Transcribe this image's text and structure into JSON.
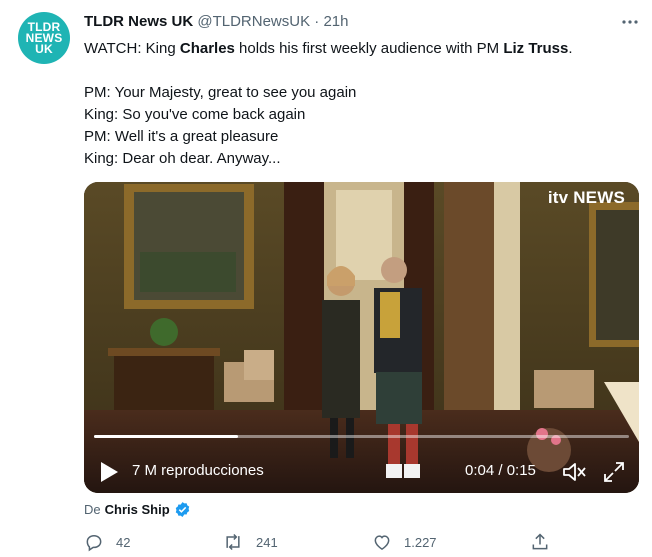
{
  "account": {
    "avatar_lines": [
      "TLDR",
      "NEWS",
      "UK"
    ],
    "display_name": "TLDR News UK",
    "handle": "@TLDRNewsUK",
    "separator": "·",
    "time": "21h"
  },
  "tweet": {
    "intro_prefix": "WATCH: King ",
    "bold_1": "Charles",
    "intro_middle": " holds his first weekly audience with PM ",
    "bold_2": "Liz Truss",
    "intro_suffix": ".",
    "dialogue": [
      "PM: Your Majesty, great to see you again",
      "King: So you've come back again",
      "PM: Well it's a great pleasure",
      "King: Dear oh dear. Anyway..."
    ]
  },
  "video": {
    "logo": "itv NEWS",
    "views": "7 M reproducciones",
    "time": "0:04 / 0:15",
    "progress": 0.27
  },
  "source": {
    "prefix": "De",
    "author": "Chris Ship"
  },
  "actions": {
    "replies": "42",
    "retweets": "241",
    "likes": "1.227"
  },
  "icons": [
    "more-icon",
    "play-icon",
    "mute-icon",
    "expand-icon",
    "verified-icon",
    "reply-icon",
    "retweet-icon",
    "like-icon",
    "share-icon"
  ],
  "colors": {
    "avatar": "#1fb4b4",
    "verified": "#1d9bf0",
    "muted_text": "#536471"
  }
}
